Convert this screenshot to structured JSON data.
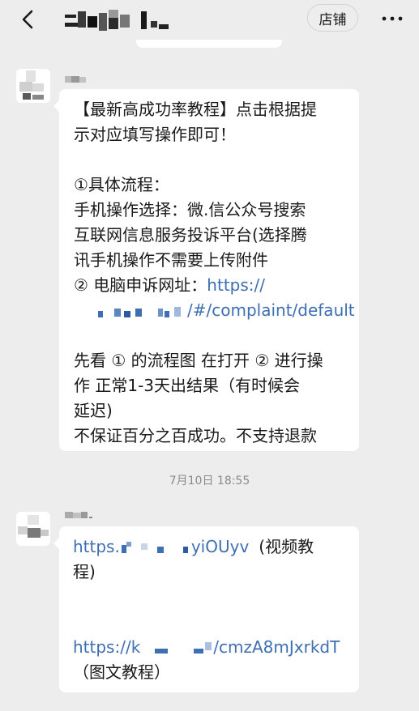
{
  "header": {
    "title": "",
    "store_label": "店铺"
  },
  "messages": [
    {
      "lines": [
        "【最新高成功率教程】点击根据提",
        "示对应填写操作即可！",
        "",
        "①具体流程：",
        "手机操作选择：微.信公众号搜索",
        "互联网信息服务投诉平台(选择腾",
        "讯手机操作不需要上传附件",
        "② 电脑申诉网址：",
        "https://",
        "/#/complaint/default",
        "",
        "先看 ① 的流程图 在打开 ② 进行操",
        "作  正常1-3天出结果（有时候会",
        "延迟)",
        "不保证百分之百成功。不支持退款"
      ]
    },
    {
      "link1_prefix": "https.",
      "link1_suffix": "yiOUyv",
      "link1_note_a": "(视频教",
      "link1_note_b": "程)",
      "link2_prefix": "https://k",
      "link2_suffix": "/cmzA8mJxrkdT",
      "link2_note": "（图文教程）"
    }
  ],
  "timestamp": "7月10日 18:55"
}
